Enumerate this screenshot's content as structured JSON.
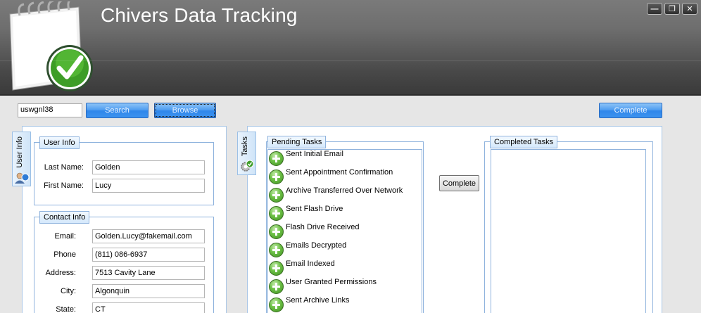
{
  "app": {
    "title": "Chivers Data Tracking"
  },
  "window": {
    "minimize_label": "—",
    "restore_label": "❐",
    "close_label": "✕"
  },
  "toolbar": {
    "search_value": "uswgnl38",
    "search_label": "Search",
    "browse_label": "Browse",
    "complete_label": "Complete"
  },
  "user_panel": {
    "tab_label": "User Info",
    "user_info": {
      "legend": "User Info",
      "last_name_label": "Last Name:",
      "last_name_value": "Golden",
      "first_name_label": "First Name:",
      "first_name_value": "Lucy"
    },
    "contact_info": {
      "legend": "Contact Info",
      "email_label": "Email:",
      "email_value": "Golden.Lucy@fakemail.com",
      "phone_label": "Phone",
      "phone_value": "(811) 086-6937",
      "address_label": "Address:",
      "address_value": "7513 Cavity Lane",
      "city_label": "City:",
      "city_value": "Algonquin",
      "state_label": "State:",
      "state_value": "CT"
    }
  },
  "tasks_panel": {
    "tab_label": "Tasks",
    "pending_legend": "Pending Tasks",
    "completed_legend": "Completed Tasks",
    "complete_label": "Complete",
    "pending_tasks": [
      "Sent Initial Email",
      "Sent Appointment Confirmation",
      "Archive Transferred Over Network",
      "Sent Flash Drive",
      "Flash Drive Received",
      "Emails Decrypted",
      "Email Indexed",
      "User Granted Permissions",
      "Sent Archive Links"
    ],
    "completed_tasks": []
  }
}
